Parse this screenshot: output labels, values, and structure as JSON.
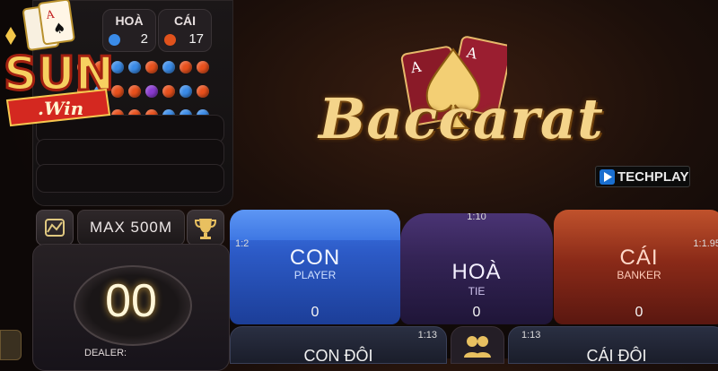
{
  "logo": {
    "line1": "SUN",
    "line2": ".Win"
  },
  "scoreboard": {
    "hoa": {
      "label": "HOÀ",
      "count": "2",
      "dot_color": "#3a8be8"
    },
    "cai": {
      "label": "CÁI",
      "count": "17",
      "dot_color": "#e0521c"
    },
    "bead_rows": [
      [
        "#e8501c",
        "#e8501c",
        "#3a8be8",
        "#3a8be8",
        "#e8501c",
        "#3a8be8",
        "#e8501c",
        "#e8501c"
      ],
      [
        "#e8501c",
        "#3a8be8",
        "#e8501c",
        "#e8501c",
        "#8a3ad0",
        "#e8501c",
        "#3a8be8",
        "#e8501c"
      ],
      [
        "#3a8be8",
        "#e8501c",
        "#e8501c",
        "#e8501c",
        "#e8501c",
        "#3a8be8",
        "#3a8be8",
        "#3a8be8"
      ]
    ]
  },
  "game": {
    "title": "Baccarat",
    "provider": "TECHPLAY"
  },
  "controls": {
    "max_prefix": "MAX",
    "max_value": "500M",
    "timer": "00",
    "dealer_label": "DEALER:"
  },
  "bets": {
    "con": {
      "name": "CON",
      "sub": "PLAYER",
      "ratio": "1:2",
      "amount": "0"
    },
    "hoa": {
      "name": "HOÀ",
      "sub": "TIE",
      "ratio": "1:10",
      "amount": "0"
    },
    "cai": {
      "name": "CÁI",
      "sub": "BANKER",
      "ratio": "1:1.95",
      "amount": "0"
    },
    "con_doi": {
      "name": "CON ĐÔI",
      "ratio": "1:13"
    },
    "cai_doi": {
      "name": "CÁI ĐÔI",
      "ratio": "1:13"
    }
  }
}
